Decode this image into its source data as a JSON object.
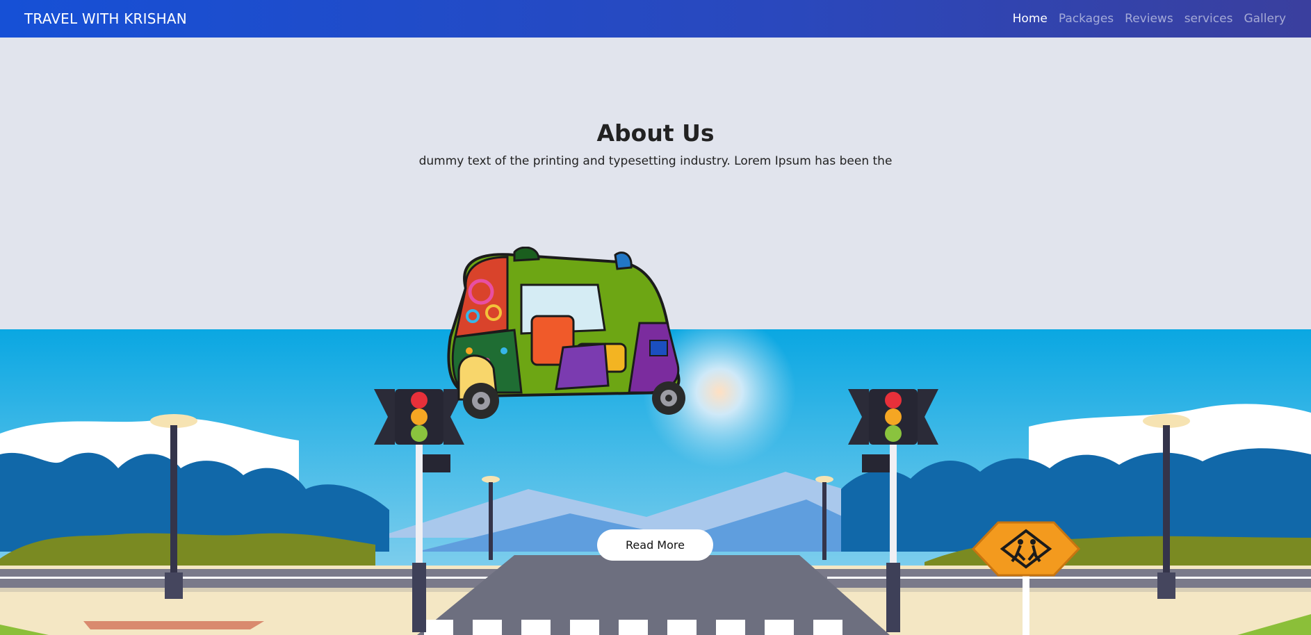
{
  "navbar": {
    "brand": "TRAVEL WITH KRISHAN",
    "links": [
      {
        "label": "Home",
        "active": true
      },
      {
        "label": "Packages",
        "active": false
      },
      {
        "label": "Reviews",
        "active": false
      },
      {
        "label": "services",
        "active": false
      },
      {
        "label": "Gallery",
        "active": false
      }
    ]
  },
  "about": {
    "title": "About Us",
    "text": "dummy text of the printing and typesetting industry. Lorem Ipsum has been the",
    "button_label": "Read More"
  },
  "icons": {
    "rickshaw": "auto-rickshaw-icon",
    "traffic_light": "traffic-light-icon",
    "street_lamp": "street-lamp-icon",
    "school_sign": "school-crossing-sign-icon"
  },
  "colors": {
    "nav_gradient_start": "#1650d6",
    "nav_gradient_end": "#3a3f9e",
    "section_bg": "#e1e4ed",
    "sky": "#19a9e3"
  }
}
